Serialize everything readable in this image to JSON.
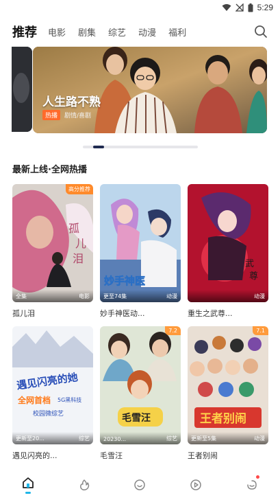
{
  "status_bar": {
    "time": "5:29"
  },
  "top_nav": {
    "tabs": [
      {
        "label": "推荐",
        "active": true
      },
      {
        "label": "电影",
        "active": false
      },
      {
        "label": "剧集",
        "active": false
      },
      {
        "label": "综艺",
        "active": false
      },
      {
        "label": "动漫",
        "active": false
      },
      {
        "label": "福利",
        "active": false
      }
    ],
    "search_icon": "search-icon"
  },
  "banner": {
    "title": "人生路不熟",
    "badge": "热播",
    "genre": "剧情/喜剧",
    "slide_index": 2,
    "slide_count": 10
  },
  "section": {
    "title": "最新上线·全网热播"
  },
  "cards": [
    {
      "name": "孤儿泪",
      "corner": "高分推荐",
      "bottom_left": "全集",
      "bottom_right": "电影"
    },
    {
      "name": "妙手神医动...",
      "corner": "",
      "bottom_left": "更至74集",
      "bottom_right": "动漫"
    },
    {
      "name": "重生之武尊...",
      "corner": "",
      "bottom_left": "",
      "bottom_right": "动漫"
    },
    {
      "name": "遇见闪亮的...",
      "corner": "",
      "bottom_left": "更新至20...",
      "bottom_right": "综艺"
    },
    {
      "name": "毛雪汪",
      "corner": "7.2",
      "bottom_left": "20230...",
      "bottom_right": "综艺"
    },
    {
      "name": "王者别闹",
      "corner": "7.1",
      "bottom_left": "更新至5集",
      "bottom_right": "动漫"
    }
  ],
  "tab_bar": {
    "items": [
      {
        "icon": "home-icon",
        "active": true
      },
      {
        "icon": "fire-icon",
        "active": false
      },
      {
        "icon": "chat-icon",
        "active": false
      },
      {
        "icon": "play-icon",
        "active": false
      },
      {
        "icon": "profile-icon",
        "active": false,
        "has_notification": true
      }
    ]
  },
  "colors": {
    "accent": "#1fb6e8",
    "badge_orange": "#ff8a2b",
    "indicator": "#1f2a50"
  }
}
